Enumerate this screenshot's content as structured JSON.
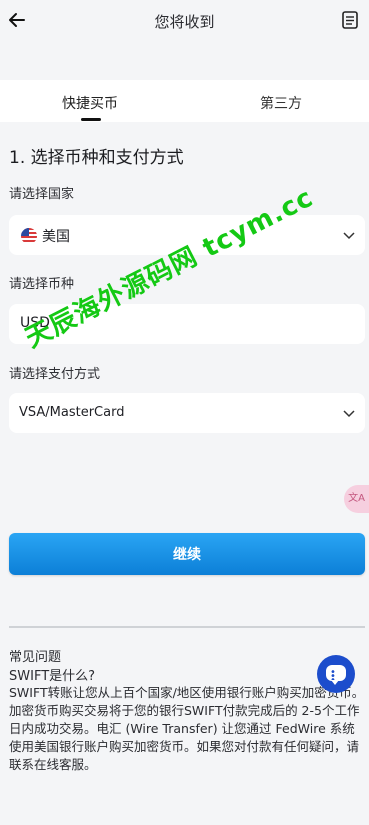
{
  "header": {
    "title": "您将收到"
  },
  "tabs": [
    {
      "label": "快捷买币"
    },
    {
      "label": "第三方"
    }
  ],
  "section": {
    "title": "1. 选择币种和支付方式"
  },
  "country": {
    "label": "请选择国家",
    "value": "美国"
  },
  "currency": {
    "label": "请选择币种",
    "value": "USD"
  },
  "payment": {
    "label": "请选择支付方式",
    "value": "VSA/MasterCard"
  },
  "continue_button": {
    "label": "继续"
  },
  "faq": {
    "heading": "常见问题",
    "question": "SWIFT是什么?",
    "answer": "SWIFT转账让您从上百个国家/地区使用银行账户购买加密货币。加密货币购买交易将于您的银行SWIFT付款完成后的 2-5个工作日内成功交易。电汇 (Wire Transfer) 让您通过 FedWire 系统使用美国银行账户购买加密货币。如果您对付款有任何疑问，请联系在线客服。"
  },
  "watermark": "天辰海外源码网 tcym.cc"
}
